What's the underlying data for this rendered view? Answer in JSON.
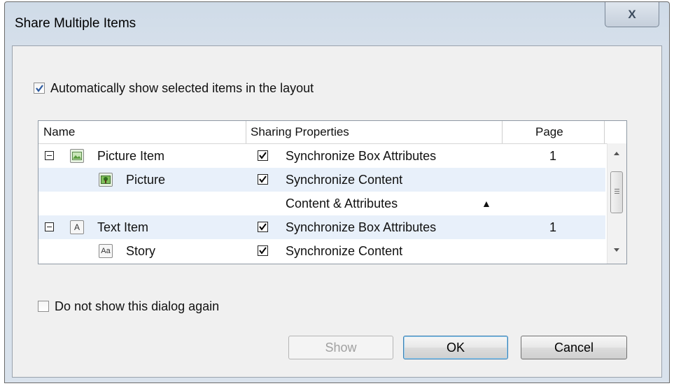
{
  "window": {
    "title": "Share Multiple Items",
    "close_glyph": "X"
  },
  "auto_show": {
    "label": "Automatically show selected items in the layout",
    "checked": true
  },
  "table": {
    "columns": {
      "name": "Name",
      "sharing": "Sharing Properties",
      "page": "Page"
    },
    "rows": [
      {
        "name": "Picture Item",
        "icon": "picture-item-icon",
        "sharing": "Synchronize Box Attributes",
        "checked": true,
        "page": "1"
      },
      {
        "name": "Picture",
        "icon": "picture-icon",
        "sharing": "Synchronize Content",
        "checked": true,
        "page": ""
      },
      {
        "name": "",
        "icon": "",
        "sharing": "Content & Attributes",
        "dropdown": true,
        "page": ""
      },
      {
        "name": "Text Item",
        "icon": "text-item-icon",
        "icon_text": "A",
        "sharing": "Synchronize Box Attributes",
        "checked": true,
        "page": "1"
      },
      {
        "name": "Story",
        "icon": "story-icon",
        "icon_text": "Aa",
        "sharing": "Synchronize Content",
        "checked": true,
        "page": ""
      }
    ]
  },
  "dont_show": {
    "label": "Do not show this dialog again",
    "checked": false
  },
  "buttons": {
    "show": "Show",
    "ok": "OK",
    "cancel": "Cancel"
  }
}
